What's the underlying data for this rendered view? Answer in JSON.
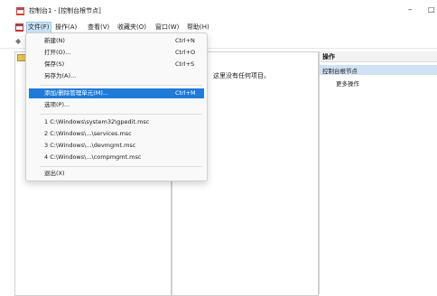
{
  "window": {
    "title": "控制台1 - [控制台根节点]",
    "minimize_glyph": "–",
    "maximize_glyph": "□"
  },
  "menubar": {
    "items": [
      {
        "label": "文件(F)"
      },
      {
        "label": "操作(A)"
      },
      {
        "label": "查看(V)"
      },
      {
        "label": "收藏夹(O)"
      },
      {
        "label": "窗口(W)"
      },
      {
        "label": "帮助(H)"
      }
    ],
    "active_index": 0
  },
  "toolbar": {
    "back_glyph": "◆"
  },
  "center": {
    "empty_message": "这里没有任何项目。"
  },
  "actions": {
    "header": "操作",
    "section": "控制台根节点",
    "more": "更多操作"
  },
  "file_menu": {
    "items": [
      {
        "label": "新建(N)",
        "shortcut": "Ctrl+N"
      },
      {
        "label": "打开(O)...",
        "shortcut": "Ctrl+O"
      },
      {
        "label": "保存(S)",
        "shortcut": "Ctrl+S"
      },
      {
        "label": "另存为(A)...",
        "shortcut": ""
      },
      {
        "label": "添加/删除管理单元(M)...",
        "shortcut": "Ctrl+M"
      },
      {
        "label": "选项(P)...",
        "shortcut": ""
      },
      {
        "label": "1 C:\\Windows\\system32\\gpedit.msc",
        "shortcut": ""
      },
      {
        "label": "2 C:\\Windows\\...\\services.msc",
        "shortcut": ""
      },
      {
        "label": "3 C:\\Windows\\...\\devmgmt.msc",
        "shortcut": ""
      },
      {
        "label": "4 C:\\Windows\\...\\compmgmt.msc",
        "shortcut": ""
      },
      {
        "label": "退出(X)",
        "shortcut": ""
      }
    ],
    "highlighted_index": 4
  },
  "colors": {
    "accent": "#1f7ad8",
    "menu_active_bg": "#cce4f7",
    "actions_section_bg": "#cfe1f3"
  },
  "icons": {
    "app": "mmc-console-icon",
    "back": "back-arrow-icon",
    "tree_node": "folder-icon"
  }
}
